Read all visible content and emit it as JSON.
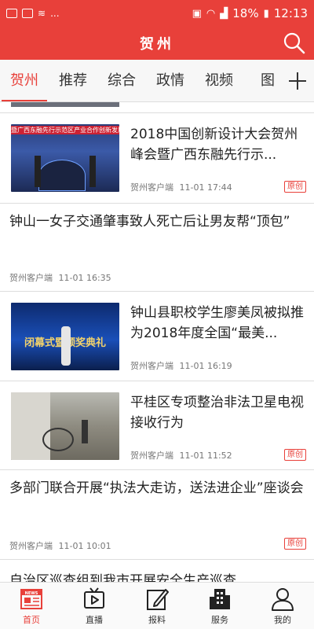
{
  "status": {
    "battery": "18%",
    "time": "12:13",
    "notif_dots": "..."
  },
  "header": {
    "title": "贺州",
    "search_icon": "search-icon"
  },
  "tabs": [
    {
      "label": "贺州",
      "active": true
    },
    {
      "label": "推荐"
    },
    {
      "label": "综合"
    },
    {
      "label": "政情"
    },
    {
      "label": "视频"
    },
    {
      "label": "图"
    }
  ],
  "colors": {
    "accent": "#e8403a",
    "text": "#222222",
    "meta": "#777777"
  },
  "feed": [
    {
      "type": "img",
      "title": "2018中国创新设计大会贺州峰会暨广西东融先行示...",
      "source": "贺州客户端",
      "time": "11-01 17:44",
      "badge": "原创",
      "thumb_text": "暨广西东融先行示范区产业合作创新发展"
    },
    {
      "type": "text",
      "title": "钟山一女子交通肇事致人死亡后让男友帮“顶包”",
      "source": "贺州客户端",
      "time": "11-01 16:35"
    },
    {
      "type": "img",
      "title": "钟山县职校学生廖美凤被拟推为2018年度全国“最美...",
      "source": "贺州客户端",
      "time": "11-01 16:19",
      "thumb_text": "闭幕式暨颁奖典礼"
    },
    {
      "type": "img",
      "title": "平桂区专项整治非法卫星电视接收行为",
      "source": "贺州客户端",
      "time": "11-01 11:52",
      "badge": "原创"
    },
    {
      "type": "text",
      "title": "多部门联合开展“执法大走访，送法进企业”座谈会",
      "source": "贺州客户端",
      "time": "11-01 10:01",
      "badge": "原创"
    },
    {
      "type": "text",
      "title": "自治区巡查组到我市开展安全生产巡查"
    }
  ],
  "bottom_nav": [
    {
      "label": "首页",
      "icon": "news-home-icon",
      "active": true
    },
    {
      "label": "直播",
      "icon": "tv-play-icon"
    },
    {
      "label": "报料",
      "icon": "edit-note-icon"
    },
    {
      "label": "服务",
      "icon": "building-service-icon"
    },
    {
      "label": "我的",
      "icon": "user-profile-icon"
    }
  ]
}
